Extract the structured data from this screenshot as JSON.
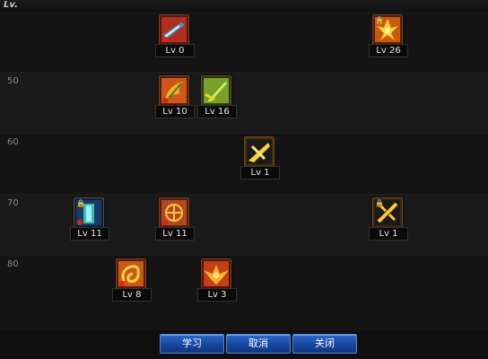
{
  "header": {
    "label": "Lv."
  },
  "rows": [
    {
      "level": ""
    },
    {
      "level": "50"
    },
    {
      "level": "60"
    },
    {
      "level": "70"
    },
    {
      "level": "80"
    }
  ],
  "skills": [
    {
      "level_text": "Lv 0",
      "icon": "sword-slash-icon",
      "color": "#b03020",
      "locked": false
    },
    {
      "level_text": "Lv 26",
      "icon": "flame-burst-icon",
      "color": "#c85a10",
      "locked": true
    },
    {
      "level_text": "Lv 10",
      "icon": "fire-strike-icon",
      "color": "#d0561a",
      "locked": false
    },
    {
      "level_text": "Lv 16",
      "icon": "green-blade-icon",
      "color": "#7aa02a",
      "locked": false
    },
    {
      "level_text": "Lv 1",
      "icon": "golden-slash-icon",
      "color": "#d0a020",
      "locked": false
    },
    {
      "level_text": "Lv 11",
      "icon": "blue-aura-icon",
      "color": "#2a6aa0",
      "locked": true
    },
    {
      "level_text": "Lv 11",
      "icon": "rune-circle-icon",
      "color": "#b04a20",
      "locked": false
    },
    {
      "level_text": "Lv 1",
      "icon": "cross-blade-icon",
      "color": "#c89a20",
      "locked": true
    },
    {
      "level_text": "Lv 8",
      "icon": "flame-whirl-icon",
      "color": "#c85a18",
      "locked": false
    },
    {
      "level_text": "Lv 3",
      "icon": "winged-flame-icon",
      "color": "#c04018",
      "locked": false
    }
  ],
  "buttons": {
    "learn": "学习",
    "cancel": "取消",
    "close": "关闭"
  }
}
